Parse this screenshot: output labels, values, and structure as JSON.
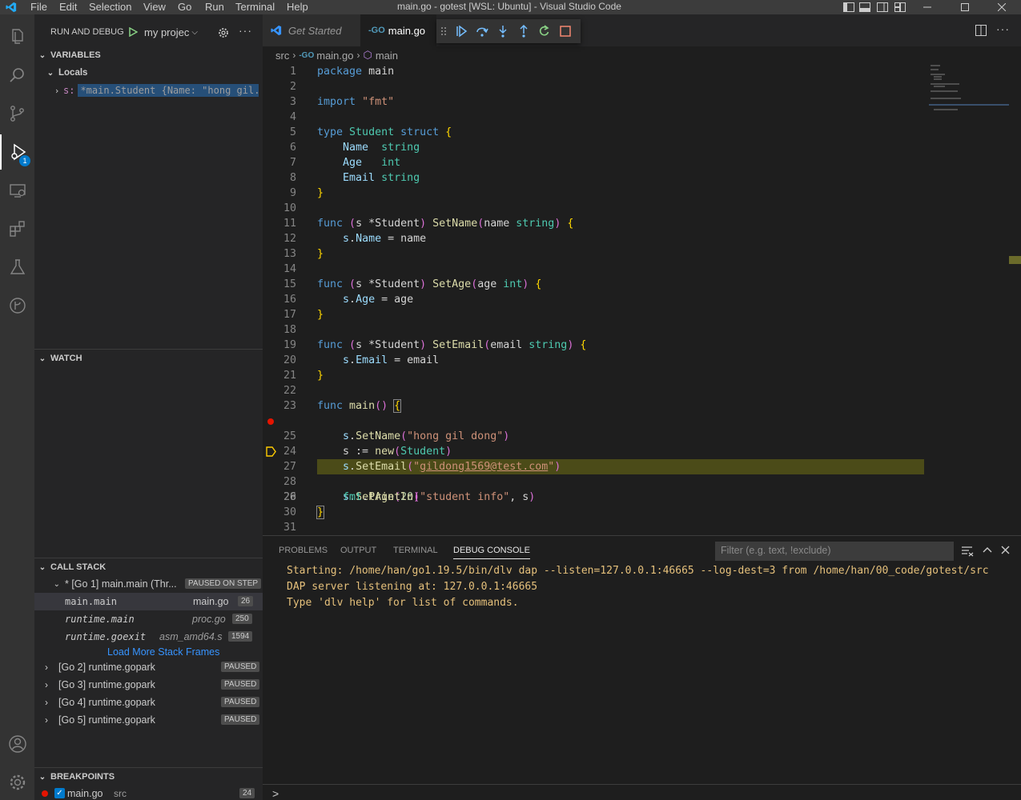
{
  "titlebar": {
    "menu": [
      "File",
      "Edit",
      "Selection",
      "View",
      "Go",
      "Run",
      "Terminal",
      "Help"
    ],
    "title": "main.go - gotest [WSL: Ubuntu] - Visual Studio Code"
  },
  "activity": {
    "debug_badge": "1"
  },
  "sidebar": {
    "run_debug_label": "RUN AND DEBUG",
    "config_name": "my projec",
    "variables": {
      "header": "VARIABLES",
      "locals_label": "Locals",
      "var_name": "s:",
      "var_value": "*main.Student {Name: \"hong gil..."
    },
    "watch": {
      "header": "WATCH"
    },
    "call_stack": {
      "header": "CALL STACK",
      "thread_label": "* [Go 1] main.main (Thr...",
      "thread_status": "PAUSED ON STEP",
      "frames": [
        {
          "name": "main.main",
          "file": "main.go",
          "line": "26"
        },
        {
          "name": "runtime.main",
          "file": "proc.go",
          "line": "250"
        },
        {
          "name": "runtime.goexit",
          "file": "asm_amd64.s",
          "line": "1594"
        }
      ],
      "load_more": "Load More Stack Frames",
      "goroutines": [
        {
          "label": "[Go 2] runtime.gopark",
          "status": "PAUSED"
        },
        {
          "label": "[Go 3] runtime.gopark",
          "status": "PAUSED"
        },
        {
          "label": "[Go 4] runtime.gopark",
          "status": "PAUSED"
        },
        {
          "label": "[Go 5] runtime.gopark",
          "status": "PAUSED"
        }
      ]
    },
    "breakpoints": {
      "header": "BREAKPOINTS",
      "item": {
        "file": "main.go",
        "dir": "src",
        "line": "24"
      }
    }
  },
  "tabs": [
    {
      "label": "Get Started"
    },
    {
      "label": "main.go"
    }
  ],
  "breadcrumb": {
    "folder": "src",
    "file": "main.go",
    "symbol": "main"
  },
  "editor": {
    "current_line": 26,
    "breakpoint_line": 24,
    "line_numbers": [
      "1",
      "2",
      "3",
      "4",
      "5",
      "6",
      "7",
      "8",
      "9",
      "10",
      "11",
      "12",
      "13",
      "14",
      "15",
      "16",
      "17",
      "18",
      "19",
      "20",
      "21",
      "22",
      "23",
      "24",
      "25",
      "26",
      "27",
      "28",
      "29",
      "30",
      "31"
    ]
  },
  "panel": {
    "tabs": [
      "PROBLEMS",
      "OUTPUT",
      "TERMINAL",
      "DEBUG CONSOLE"
    ],
    "filter_placeholder": "Filter (e.g. text, !exclude)",
    "console_lines": [
      "Starting: /home/han/go1.19.5/bin/dlv dap --listen=127.0.0.1:46665 --log-dest=3 from /home/han/00_code/gotest/src",
      "DAP server listening at: 127.0.0.1:46665",
      "Type 'dlv help' for list of commands."
    ],
    "prompt": ">"
  },
  "colors": {
    "accent": "#007acc",
    "breakpoint": "#e51400",
    "current_line_bg": "#4b4b18",
    "console_text": "#e5c07b"
  }
}
